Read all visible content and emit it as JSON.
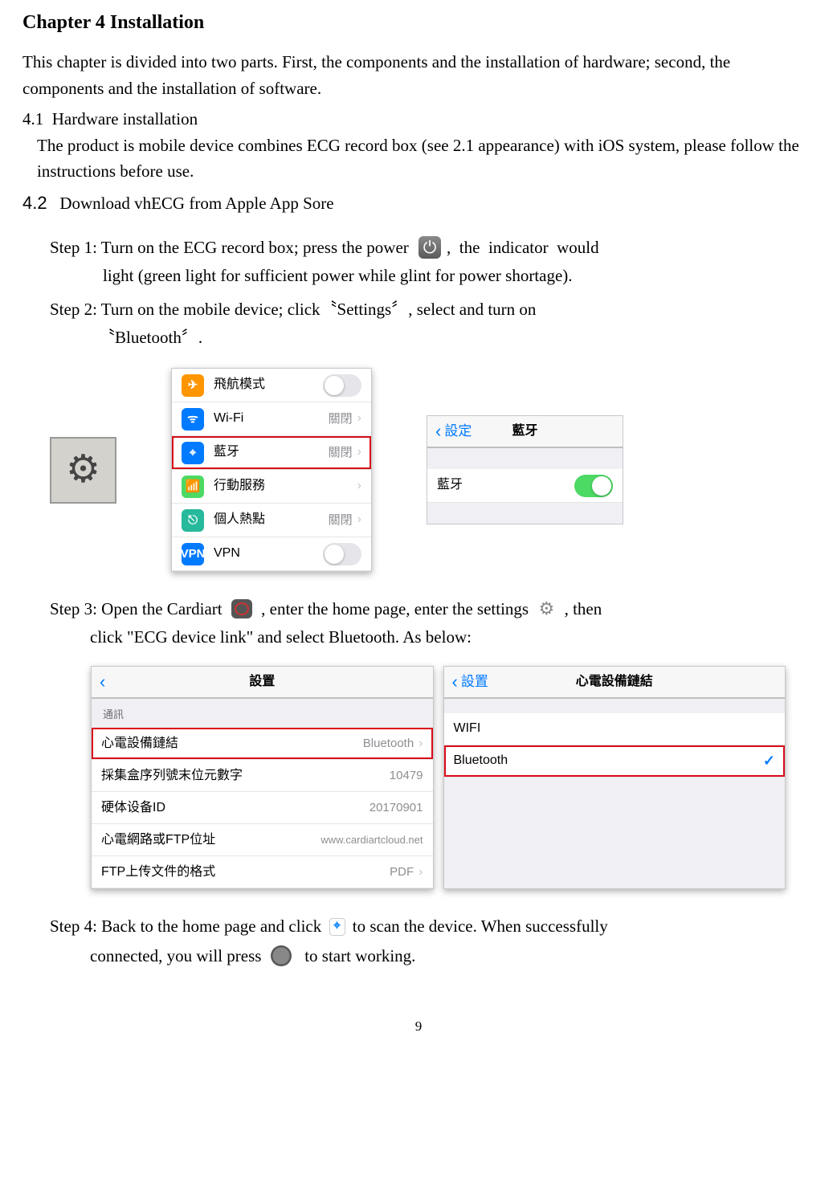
{
  "chapter_title": "Chapter 4 Installation",
  "intro": "This chapter is divided into two parts. First, the components and the installation of hardware; second, the components and the installation of software.",
  "sec41": {
    "num": "4.1",
    "title": "Hardware installation",
    "body": "The product is mobile device combines ECG record box (see 2.1 appearance) with iOS system, please follow the instructions before use."
  },
  "sec42": {
    "num": "4.2",
    "title": "Download vhECG from Apple App Sore"
  },
  "step1": {
    "a": "Step 1: Turn on the ECG record box; press the power ",
    "b": ",  the  indicator  would",
    "sub": "light (green light for sufficient power while glint for power shortage)."
  },
  "step2": {
    "a": "Step 2: Turn on the mobile device; click〝Settings〞, select and turn on",
    "sub": "〝Bluetooth〞."
  },
  "step3": {
    "a": "Step 3: Open the Cardiart ",
    "b": " , enter the home page, enter the settings ",
    "c": " , then",
    "sub": "click \"ECG device link\" and select Bluetooth. As below:"
  },
  "step4": {
    "a": "Step 4: Back to the home page and click ",
    "b": " to scan the device. When successfully",
    "sub_a": "connected, you will press ",
    "sub_b": "  to start working."
  },
  "ios_settings_panel": {
    "items": [
      {
        "icon": "ic-orange",
        "glyph": "✈",
        "label": "飛航模式",
        "value": "",
        "toggle": "off"
      },
      {
        "icon": "ic-blue",
        "glyph": "ᯤ",
        "label": "Wi-Fi",
        "value": "關閉",
        "chev": true
      },
      {
        "icon": "ic-blue",
        "glyph": "⌖",
        "label": "藍牙",
        "value": "關閉",
        "chev": true,
        "hl": true
      },
      {
        "icon": "ic-green",
        "glyph": "⟳",
        "label": "行動服務",
        "value": "",
        "chev": true
      },
      {
        "icon": "ic-teal",
        "glyph": "⎋",
        "label": "個人熱點",
        "value": "關閉",
        "chev": true
      },
      {
        "icon": "ic-vpn",
        "glyph": "VPN",
        "label": "VPN",
        "value": "",
        "toggle": "off"
      }
    ]
  },
  "bt_panel": {
    "back": "設定",
    "title": "藍牙",
    "row_label": "藍牙"
  },
  "app_settings_panel": {
    "title": "設置",
    "section": "通訊",
    "rows": {
      "r1_lbl": "心電設備鏈結",
      "r1_val": "Bluetooth",
      "r2_lbl": "採集盒序列號末位元數字",
      "r2_val": "10479",
      "r3_lbl": "硬体设备ID",
      "r3_val": "20170901",
      "r4_lbl": "心電網路或FTP位址",
      "r4_val": "www.cardiartcloud.net",
      "r5_lbl": "FTP上传文件的格式",
      "r5_val": "PDF"
    }
  },
  "link_panel": {
    "back": "設置",
    "title": "心電設備鏈結",
    "opt1": "WIFI",
    "opt2": "Bluetooth"
  },
  "page_num": "9"
}
